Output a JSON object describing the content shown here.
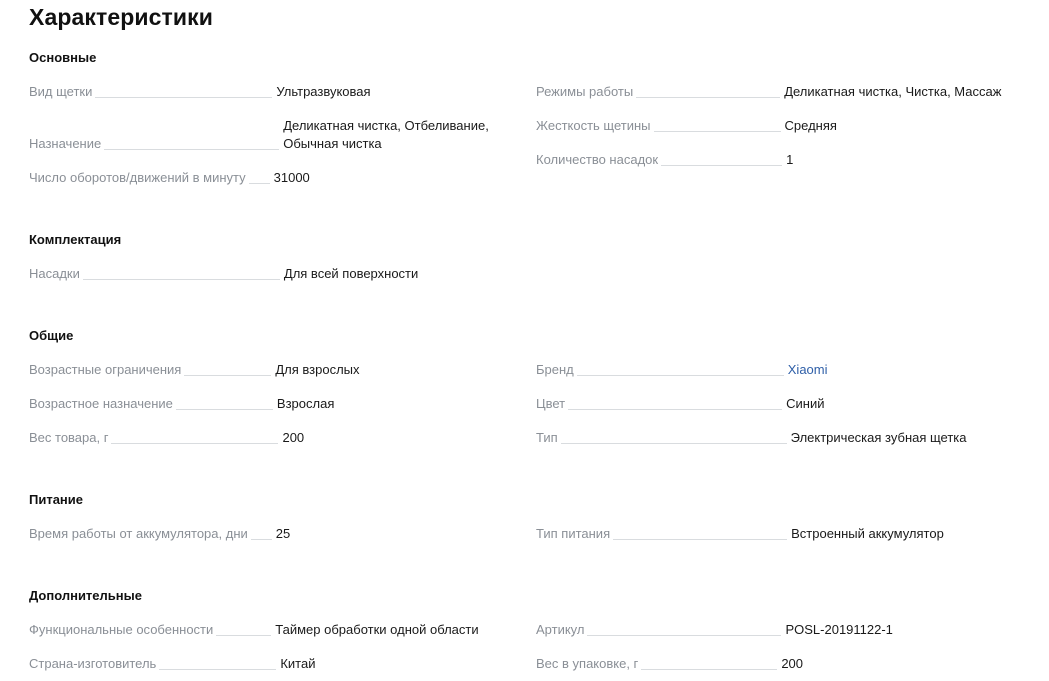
{
  "title": "Характеристики",
  "sections": {
    "main": {
      "title": "Основные",
      "left": [
        {
          "label": "Вид щетки",
          "value": "Ультразвуковая"
        },
        {
          "label": "Назначение",
          "value_line1": "Деликатная чистка, Отбеливание,",
          "value_line2": "Обычная чистка"
        },
        {
          "label": "Число оборотов/движений в минуту",
          "value": "31000"
        }
      ],
      "right": [
        {
          "label": "Режимы работы",
          "value": "Деликатная чистка, Чистка, Массаж"
        },
        {
          "label": "Жесткость щетины",
          "value": "Средняя"
        },
        {
          "label": "Количество насадок",
          "value": "1"
        }
      ]
    },
    "kit": {
      "title": "Комплектация",
      "left": [
        {
          "label": "Насадки",
          "value": "Для всей поверхности"
        }
      ]
    },
    "general": {
      "title": "Общие",
      "left": [
        {
          "label": "Возрастные ограничения",
          "value": "Для взрослых"
        },
        {
          "label": "Возрастное назначение",
          "value": "Взрослая"
        },
        {
          "label": "Вес товара, г",
          "value": "200"
        }
      ],
      "right": [
        {
          "label": "Бренд",
          "value": "Xiaomi"
        },
        {
          "label": "Цвет",
          "value": "Синий"
        },
        {
          "label": "Тип",
          "value": "Электрическая зубная щетка"
        }
      ]
    },
    "power": {
      "title": "Питание",
      "left": [
        {
          "label": "Время работы от аккумулятора, дни",
          "value": "25"
        }
      ],
      "right": [
        {
          "label": "Тип питания",
          "value": "Встроенный аккумулятор"
        }
      ]
    },
    "extra": {
      "title": "Дополнительные",
      "left": [
        {
          "label": "Функциональные особенности",
          "value": "Таймер обработки одной области"
        },
        {
          "label": "Страна-изготовитель",
          "value": "Китай"
        }
      ],
      "right": [
        {
          "label": "Артикул",
          "value": "POSL-20191122-1"
        },
        {
          "label": "Вес в упаковке, г",
          "value": "200"
        }
      ]
    }
  },
  "colors": {
    "label": "#8a8f96",
    "value": "#1a1a1a",
    "link": "#2f5fa8",
    "leader": "#d9dcdf"
  }
}
